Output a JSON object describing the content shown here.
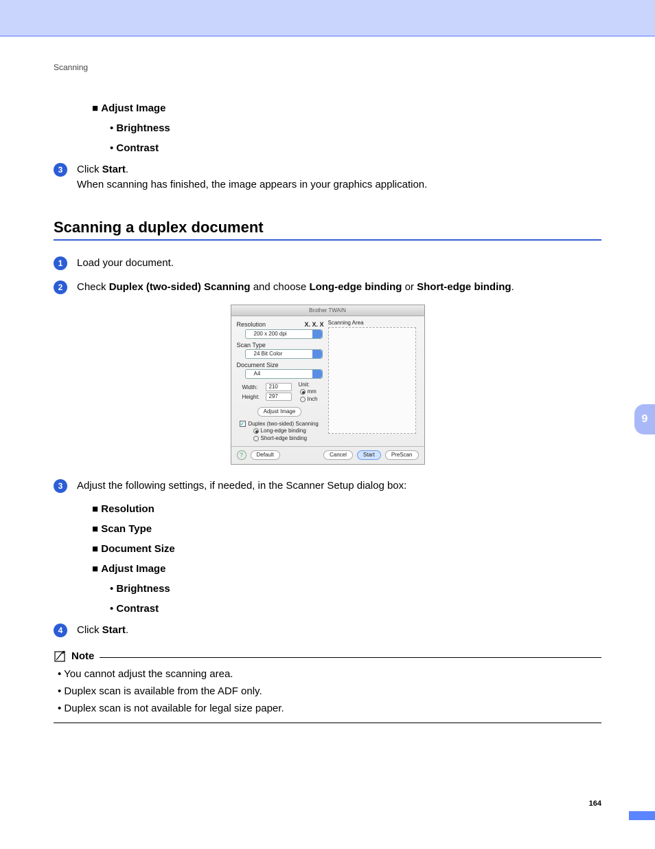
{
  "section": "Scanning",
  "adjust": {
    "title": "Adjust Image",
    "brightness": "Brightness",
    "contrast": "Contrast"
  },
  "step3a": {
    "num": "3",
    "line1_a": "Click ",
    "line1_b": "Start",
    "line1_c": ".",
    "line2": "When scanning has finished, the image appears in your graphics application."
  },
  "duplex_title": "Scanning a duplex document",
  "ds1": {
    "num": "1",
    "text": "Load your document."
  },
  "ds2": {
    "num": "2",
    "a": "Check ",
    "b": "Duplex (two-sided) Scanning",
    "c": " and choose ",
    "d": "Long-edge binding",
    "e": " or ",
    "f": "Short-edge binding",
    "g": "."
  },
  "dialog": {
    "title": "Brother TWAIN",
    "version": "X. X. X",
    "resolution_label": "Resolution",
    "resolution_value": "200 x 200 dpi",
    "scantype_label": "Scan Type",
    "scantype_value": "24 Bit Color",
    "docsize_label": "Document Size",
    "docsize_value": "A4",
    "width_label": "Width:",
    "width_value": "210",
    "height_label": "Height:",
    "height_value": "297",
    "unit_label": "Unit:",
    "unit_mm": "mm",
    "unit_inch": "Inch",
    "adjust_image_btn": "Adjust Image",
    "duplex_check": "Duplex (two-sided) Scanning",
    "long_edge": "Long-edge binding",
    "short_edge": "Short-edge binding",
    "scanning_area": "Scanning Area",
    "help": "?",
    "default_btn": "Default",
    "cancel_btn": "Cancel",
    "start_btn": "Start",
    "prescan_btn": "PreScan"
  },
  "ds3": {
    "num": "3",
    "text": "Adjust the following settings, if needed, in the Scanner Setup dialog box:",
    "items": {
      "resolution": "Resolution",
      "scantype": "Scan Type",
      "docsize": "Document Size",
      "adjust": "Adjust Image",
      "brightness": "Brightness",
      "contrast": "Contrast"
    }
  },
  "ds4": {
    "num": "4",
    "a": "Click ",
    "b": "Start",
    "c": "."
  },
  "note": {
    "heading": "Note",
    "i1": "You cannot adjust the scanning area.",
    "i2": "Duplex scan is available from the ADF only.",
    "i3": "Duplex scan is not available for legal size paper."
  },
  "chapter": "9",
  "page_number": "164"
}
